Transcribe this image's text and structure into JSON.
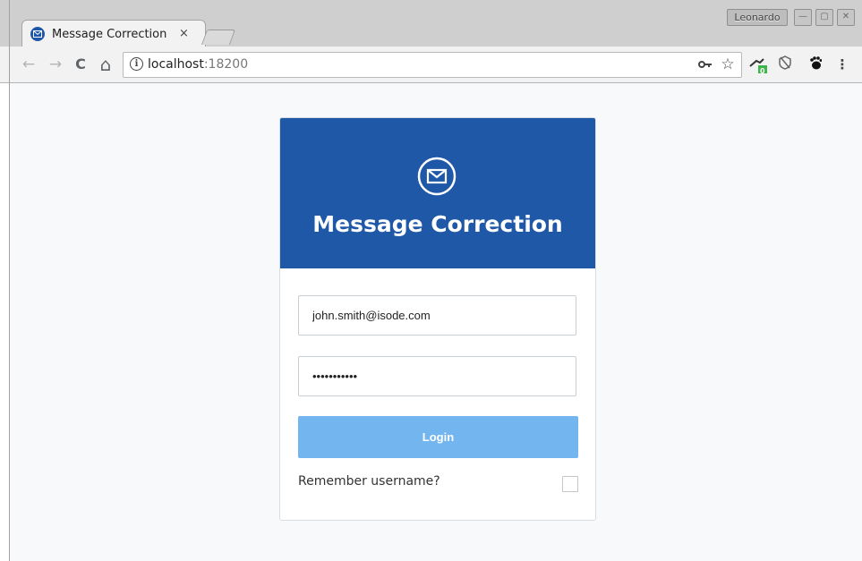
{
  "browser": {
    "tab_title": "Message Correction",
    "tab_close": "×",
    "profile_name": "Leonardo",
    "window_controls": {
      "minimize": "—",
      "maximize": "▢",
      "close": "✕"
    },
    "nav": {
      "back": "←",
      "forward": "→",
      "reload": "C",
      "home": "⌂"
    },
    "url": {
      "host": "localhost",
      "port": ":18200"
    },
    "toolbar_icons": [
      "key-icon",
      "star-icon",
      "extension-icon",
      "shield-icon",
      "gnome-foot-icon",
      "menu-icon"
    ],
    "extension_badge": "0"
  },
  "login": {
    "title": "Message Correction",
    "username_value": "john.smith@isode.com",
    "password_mask": "•••••••••••",
    "login_label": "Login",
    "remember_label": "Remember username?",
    "remember_checked": false
  },
  "colors": {
    "header": "#2058a8",
    "login_button": "#72b5ef",
    "page_bg": "#f8f9fb"
  }
}
